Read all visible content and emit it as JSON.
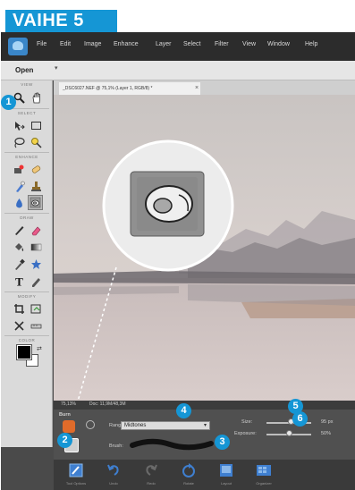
{
  "step": {
    "label": "VAIHE 5"
  },
  "menu": {
    "items": [
      "File",
      "Edit",
      "Image",
      "Enhance",
      "Layer",
      "Select",
      "Filter",
      "View",
      "Window",
      "Help"
    ]
  },
  "toolbar": {
    "open_label": "Open"
  },
  "toolbox": {
    "sections": {
      "view": "VIEW",
      "select": "SELECT",
      "enhance": "ENHANCE",
      "draw": "DRAW",
      "modify": "MODIFY",
      "color": "COLOR"
    }
  },
  "document": {
    "tab_title": "_DSC6027.NEF @ 75,1% (Layer 1, RGB/8) *"
  },
  "status": {
    "zoom": "75,13%",
    "doc_size": "Doc: 11,9M/48,3M"
  },
  "options": {
    "panel_label": "Burn",
    "range_label": "Range:",
    "range_value": "Midtones",
    "brush_label": "Brush:",
    "size_label": "Size:",
    "size_value": "95 px",
    "exposure_label": "Exposure:",
    "exposure_value": "50%",
    "size_fraction": 0.55,
    "exposure_fraction": 0.5
  },
  "bottombar": {
    "items": [
      {
        "label": "Tool Options"
      },
      {
        "label": "Undo"
      },
      {
        "label": "Redo"
      },
      {
        "label": "Rotate"
      },
      {
        "label": "Layout"
      },
      {
        "label": "Organizer"
      }
    ]
  },
  "badges": [
    "1",
    "2",
    "3",
    "4",
    "5",
    "6"
  ],
  "colors": {
    "accent": "#1596d5",
    "foreground": "#000000",
    "background": "#ffffff"
  }
}
